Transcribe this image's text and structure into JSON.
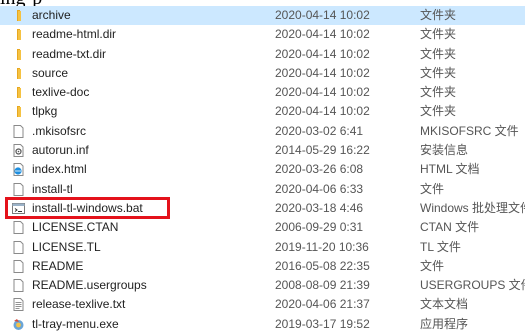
{
  "top_caption": "ing-p",
  "files": [
    {
      "name": "archive",
      "date": "2020-04-14 10:02",
      "type": "文件夹",
      "icon": "folder-icon"
    },
    {
      "name": "readme-html.dir",
      "date": "2020-04-14 10:02",
      "type": "文件夹",
      "icon": "folder-icon"
    },
    {
      "name": "readme-txt.dir",
      "date": "2020-04-14 10:02",
      "type": "文件夹",
      "icon": "folder-icon"
    },
    {
      "name": "source",
      "date": "2020-04-14 10:02",
      "type": "文件夹",
      "icon": "folder-icon"
    },
    {
      "name": "texlive-doc",
      "date": "2020-04-14 10:02",
      "type": "文件夹",
      "icon": "folder-icon"
    },
    {
      "name": "tlpkg",
      "date": "2020-04-14 10:02",
      "type": "文件夹",
      "icon": "folder-icon"
    },
    {
      "name": ".mkisofsrc",
      "date": "2020-03-02 6:41",
      "type": "MKISOFSRC 文件",
      "icon": "blank-file-icon"
    },
    {
      "name": "autorun.inf",
      "date": "2014-05-29 16:22",
      "type": "安装信息",
      "icon": "setup-info-icon"
    },
    {
      "name": "index.html",
      "date": "2020-03-26 6:08",
      "type": "HTML 文档",
      "icon": "browser-file-icon"
    },
    {
      "name": "install-tl",
      "date": "2020-04-06 6:33",
      "type": "文件",
      "icon": "blank-file-icon"
    },
    {
      "name": "install-tl-windows.bat",
      "date": "2020-03-18 4:46",
      "type": "Windows 批处理文件",
      "icon": "batch-file-icon"
    },
    {
      "name": "LICENSE.CTAN",
      "date": "2006-09-29 0:31",
      "type": "CTAN 文件",
      "icon": "blank-file-icon"
    },
    {
      "name": "LICENSE.TL",
      "date": "2019-11-20 10:36",
      "type": "TL 文件",
      "icon": "blank-file-icon"
    },
    {
      "name": "README",
      "date": "2016-05-08 22:35",
      "type": "文件",
      "icon": "blank-file-icon"
    },
    {
      "name": "README.usergroups",
      "date": "2008-08-09 21:39",
      "type": "USERGROUPS 文件",
      "icon": "blank-file-icon"
    },
    {
      "name": "release-texlive.txt",
      "date": "2020-04-06 21:37",
      "type": "文本文档",
      "icon": "text-file-icon"
    },
    {
      "name": "tl-tray-menu.exe",
      "date": "2019-03-17 19:52",
      "type": "应用程序",
      "icon": "exe-icon"
    }
  ],
  "selected_index": 0,
  "highlight_color": "#e4121b",
  "folder_color": "#f5c242"
}
